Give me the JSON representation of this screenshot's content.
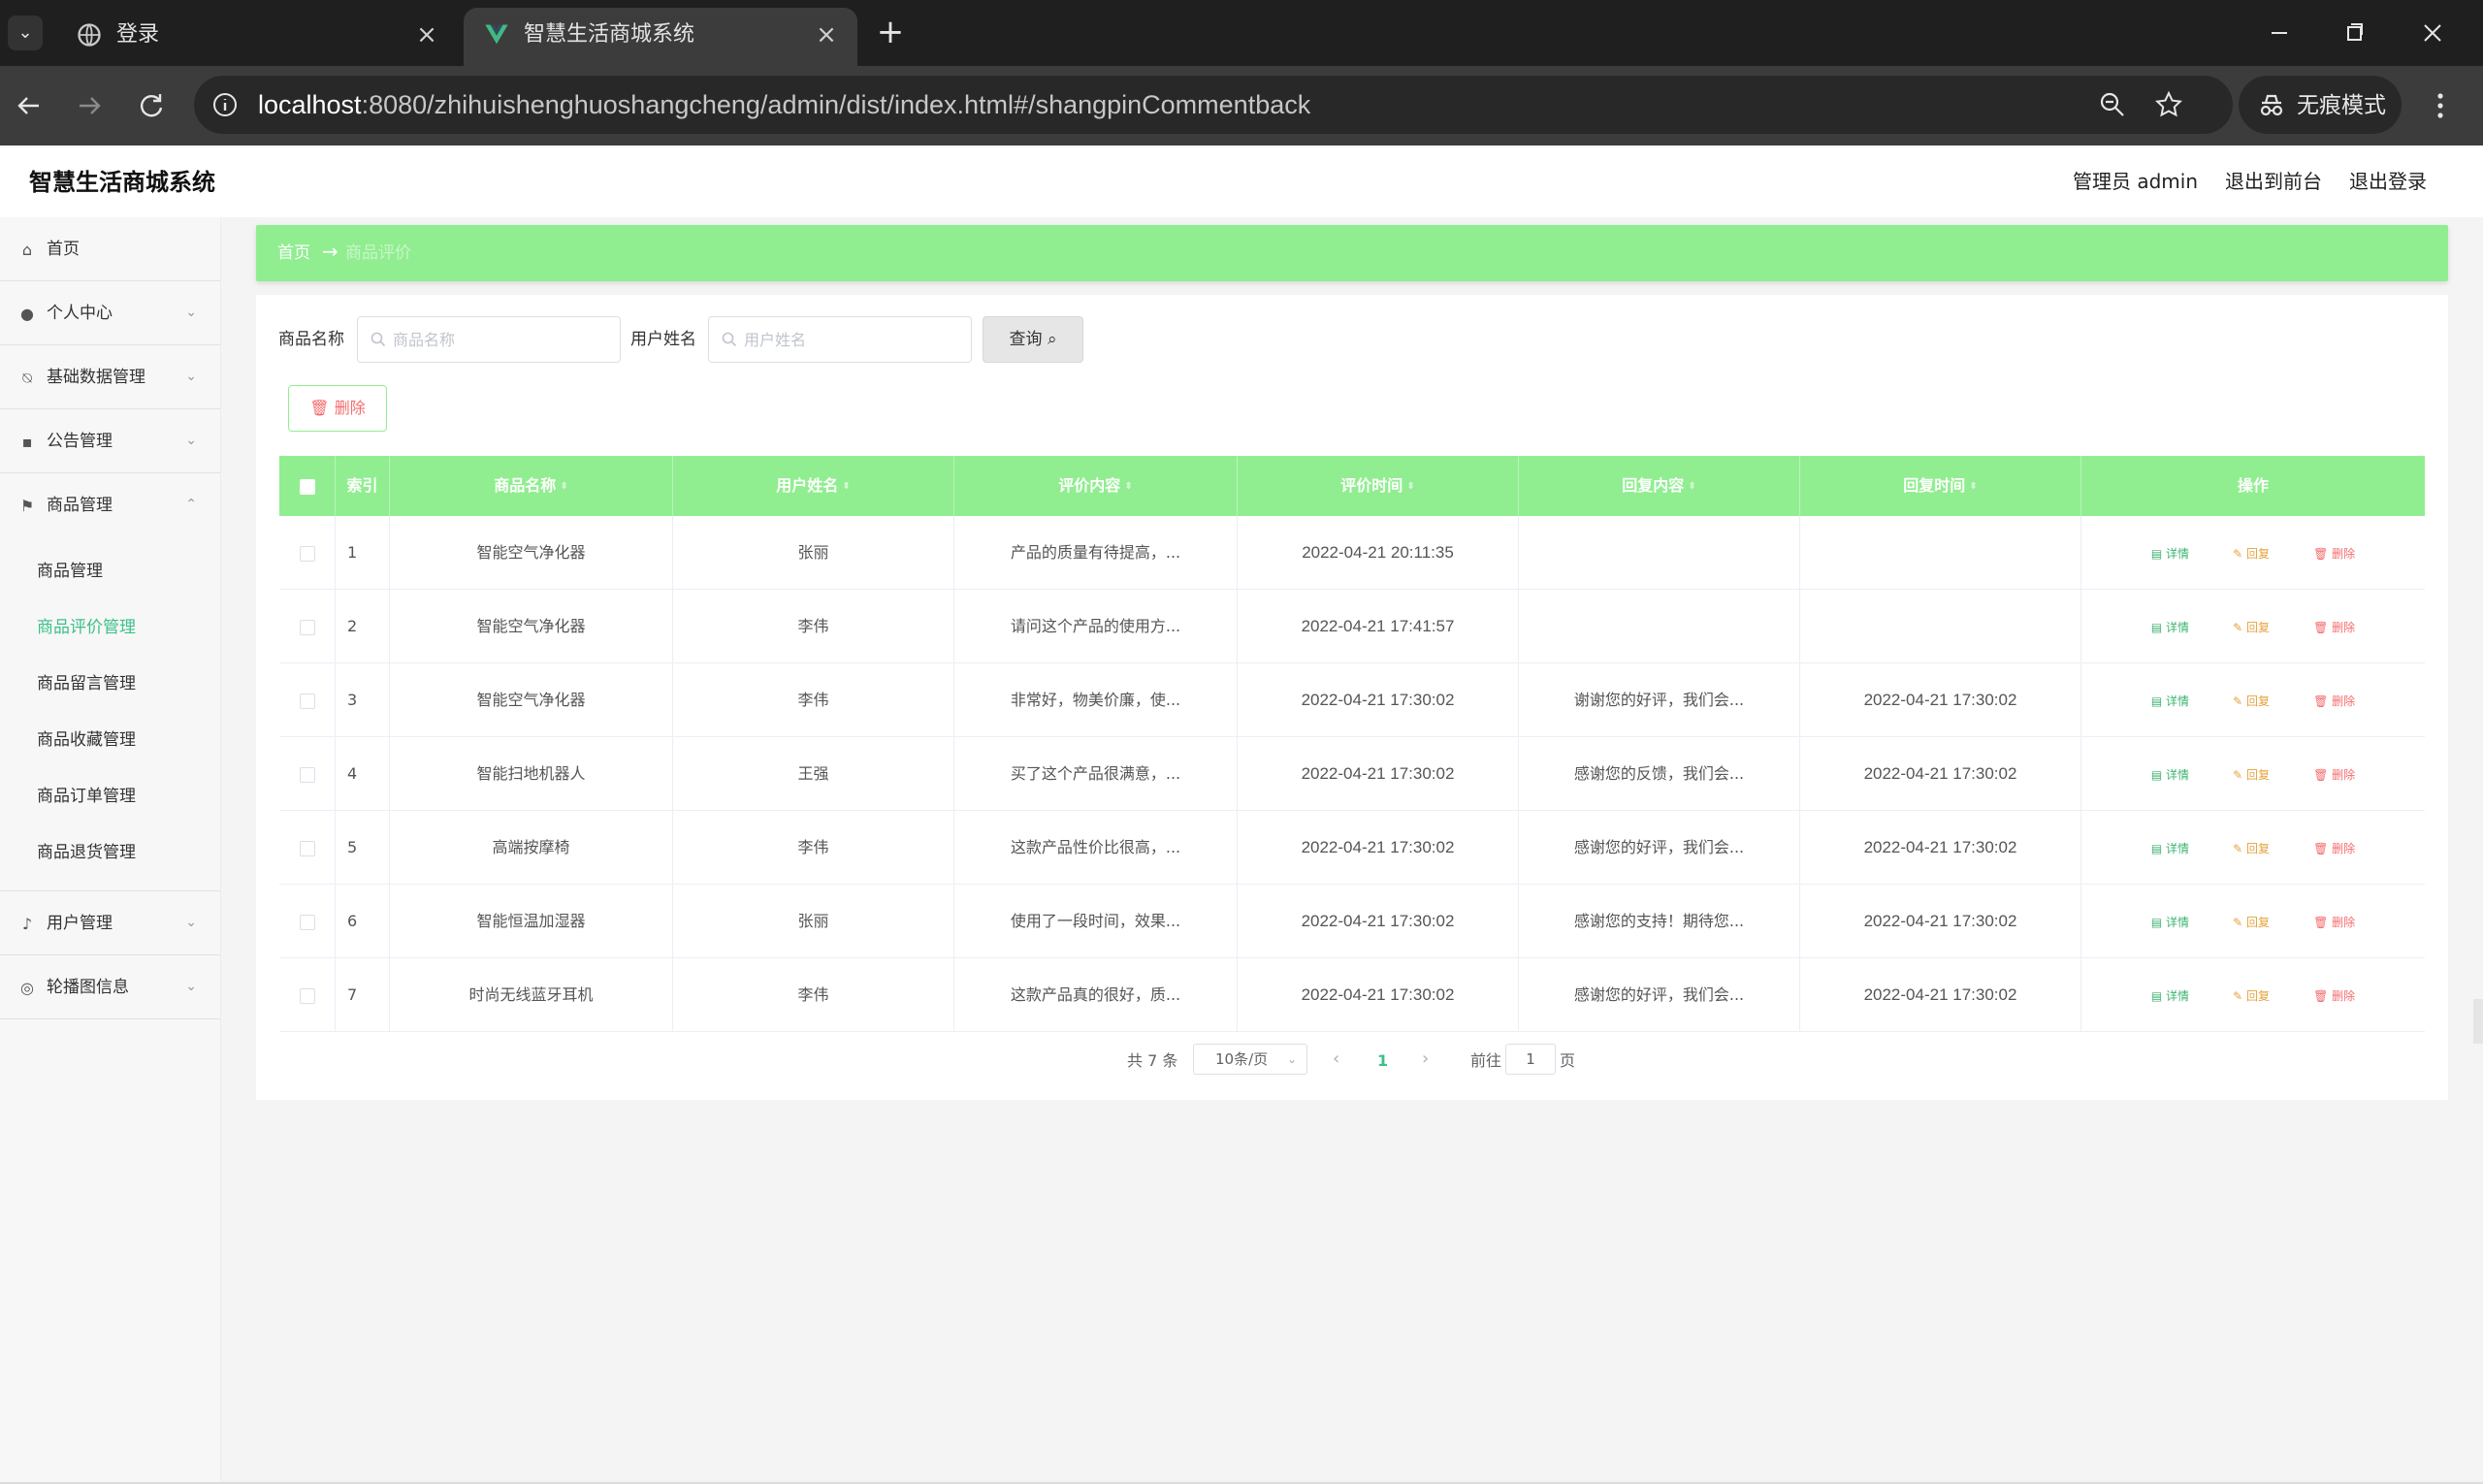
{
  "browser": {
    "tabs": [
      {
        "title": "登录",
        "active": false
      },
      {
        "title": "智慧生活商城系统",
        "active": true
      }
    ],
    "url_host": "localhost",
    "url_rest": ":8080/zhihuishenghuoshangcheng/admin/dist/index.html#/shangpinCommentback",
    "incognito_label": "无痕模式",
    "colors": {
      "tabstrip": "#1f1f1f",
      "toolbar": "#3c3c3c",
      "omnibox": "#282828"
    }
  },
  "app": {
    "title": "智慧生活商城系统",
    "header_links": {
      "admin": "管理员 admin",
      "frontend": "退出到前台",
      "logout": "退出登录"
    },
    "accent_color": "#90ee90",
    "active_menu_color": "#3cc08a"
  },
  "sidebar": {
    "items": [
      {
        "label": "首页",
        "icon": "home-icon"
      },
      {
        "label": "个人中心",
        "icon": "user-icon"
      },
      {
        "label": "基础数据管理",
        "icon": "bell-off-icon"
      },
      {
        "label": "公告管理",
        "icon": "box-icon"
      },
      {
        "label": "商品管理",
        "icon": "flag-icon"
      },
      {
        "label": "用户管理",
        "icon": "microphone-icon"
      },
      {
        "label": "轮播图信息",
        "icon": "compass-icon"
      }
    ],
    "submenu": [
      {
        "label": "商品管理"
      },
      {
        "label": "商品评价管理",
        "active": true
      },
      {
        "label": "商品留言管理"
      },
      {
        "label": "商品收藏管理"
      },
      {
        "label": "商品订单管理"
      },
      {
        "label": "商品退货管理"
      }
    ]
  },
  "breadcrumb": {
    "home": "首页",
    "arrow": "→",
    "current": "商品评价"
  },
  "search": {
    "product_label": "商品名称",
    "product_placeholder": "商品名称",
    "user_label": "用户姓名",
    "user_placeholder": "用户姓名",
    "query_label": "查询"
  },
  "actions": {
    "delete_label": "删除"
  },
  "table": {
    "headers": {
      "index": "索引",
      "product": "商品名称",
      "user": "用户姓名",
      "content": "评价内容",
      "time": "评价时间",
      "reply": "回复内容",
      "reply_time": "回复时间",
      "ops": "操作"
    },
    "ops": {
      "detail": "详情",
      "reply": "回复",
      "delete": "删除"
    },
    "rows": [
      {
        "index": "1",
        "product": "智能空气净化器",
        "user": "张丽",
        "content": "产品的质量有待提高，...",
        "time": "2022-04-21 20:11:35",
        "reply": "",
        "reply_time": ""
      },
      {
        "index": "2",
        "product": "智能空气净化器",
        "user": "李伟",
        "content": "请问这个产品的使用方...",
        "time": "2022-04-21 17:41:57",
        "reply": "",
        "reply_time": ""
      },
      {
        "index": "3",
        "product": "智能空气净化器",
        "user": "李伟",
        "content": "非常好，物美价廉，使...",
        "time": "2022-04-21 17:30:02",
        "reply": "谢谢您的好评，我们会...",
        "reply_time": "2022-04-21 17:30:02"
      },
      {
        "index": "4",
        "product": "智能扫地机器人",
        "user": "王强",
        "content": "买了这个产品很满意，...",
        "time": "2022-04-21 17:30:02",
        "reply": "感谢您的反馈，我们会...",
        "reply_time": "2022-04-21 17:30:02"
      },
      {
        "index": "5",
        "product": "高端按摩椅",
        "user": "李伟",
        "content": "这款产品性价比很高，...",
        "time": "2022-04-21 17:30:02",
        "reply": "感谢您的好评，我们会...",
        "reply_time": "2022-04-21 17:30:02"
      },
      {
        "index": "6",
        "product": "智能恒温加湿器",
        "user": "张丽",
        "content": "使用了一段时间，效果...",
        "time": "2022-04-21 17:30:02",
        "reply": "感谢您的支持！期待您...",
        "reply_time": "2022-04-21 17:30:02"
      },
      {
        "index": "7",
        "product": "时尚无线蓝牙耳机",
        "user": "李伟",
        "content": "这款产品真的很好，质...",
        "time": "2022-04-21 17:30:02",
        "reply": "感谢您的好评，我们会...",
        "reply_time": "2022-04-21 17:30:02"
      }
    ]
  },
  "pagination": {
    "total": "共 7 条",
    "page_size": "10条/页",
    "current_page": "1",
    "goto_label": "前往",
    "goto_value": "1",
    "page_suffix": "页"
  }
}
